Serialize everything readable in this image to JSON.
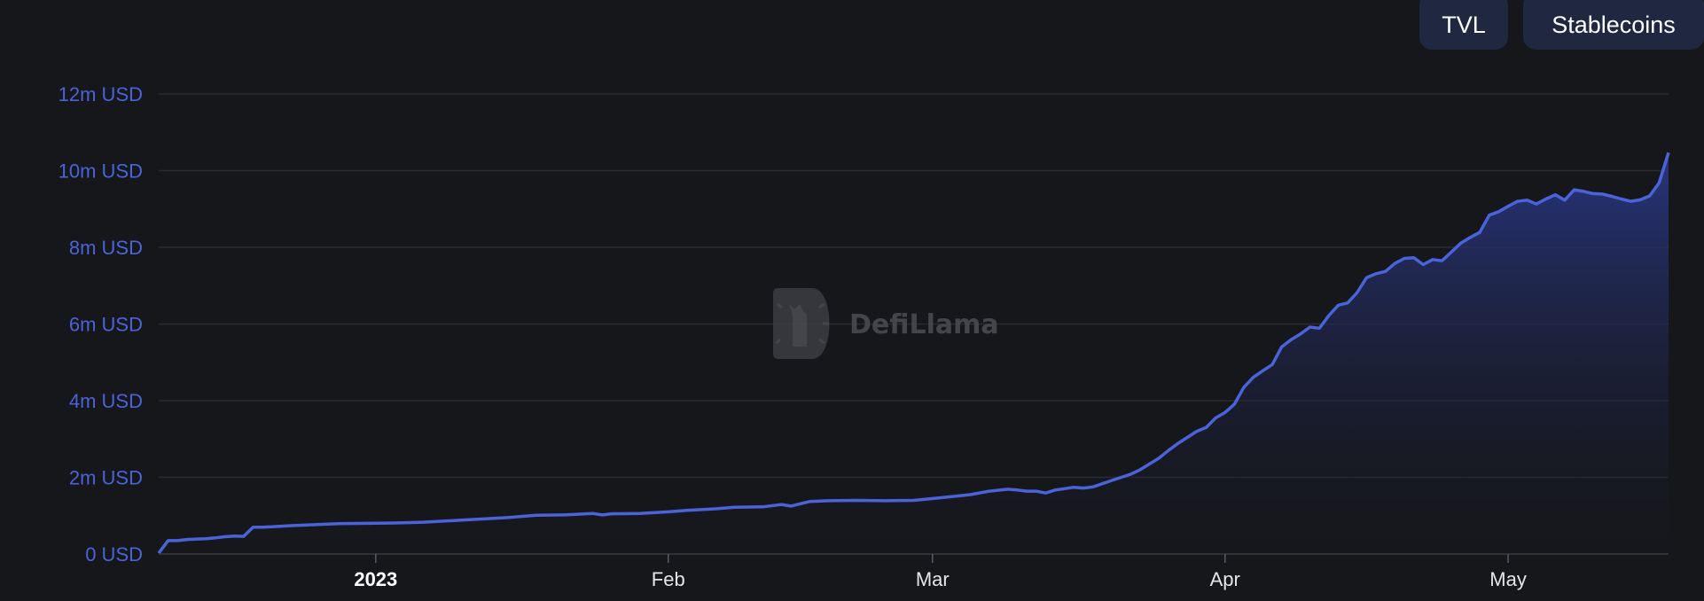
{
  "toggles": [
    {
      "label": "TVL"
    },
    {
      "label": "Stablecoins"
    }
  ],
  "watermark": "DefiLlama",
  "colors": {
    "background": "#16171b",
    "line": "#4b63d9",
    "area_top": "#2b3a8e",
    "grid": "#2a2b31",
    "y_tick_text": "#4b63d9",
    "button_bg": "#1f2840"
  },
  "chart_data": {
    "type": "area",
    "title": "",
    "xlabel": "",
    "ylabel": "",
    "ylim": [
      0,
      12
    ],
    "y_unit": "m USD",
    "y_ticks": [
      {
        "value": 0,
        "label": "0 USD"
      },
      {
        "value": 2,
        "label": "2m USD"
      },
      {
        "value": 4,
        "label": "4m USD"
      },
      {
        "value": 6,
        "label": "6m USD"
      },
      {
        "value": 8,
        "label": "8m USD"
      },
      {
        "value": 10,
        "label": "10m USD"
      },
      {
        "value": 12,
        "label": "12m USD"
      }
    ],
    "x_range": [
      "2022-12-09",
      "2023-05-18"
    ],
    "x_ticks": [
      {
        "date": "2023-01-01",
        "label": "2023",
        "bold": true
      },
      {
        "date": "2023-02-01",
        "label": "Feb",
        "bold": false
      },
      {
        "date": "2023-03-01",
        "label": "Mar",
        "bold": false
      },
      {
        "date": "2023-04-01",
        "label": "Apr",
        "bold": false
      },
      {
        "date": "2023-05-01",
        "label": "May",
        "bold": false
      }
    ],
    "grid": true,
    "legend": "none",
    "series": [
      {
        "x": [
          "2022-12-09",
          "2022-12-10",
          "2022-12-11",
          "2022-12-12",
          "2022-12-13",
          "2022-12-14",
          "2022-12-15",
          "2022-12-16",
          "2022-12-17",
          "2022-12-18",
          "2022-12-19",
          "2022-12-20",
          "2022-12-21",
          "2022-12-23",
          "2022-12-25",
          "2022-12-28",
          "2022-12-31",
          "2023-01-03",
          "2023-01-06",
          "2023-01-09",
          "2023-01-12",
          "2023-01-15",
          "2023-01-18",
          "2023-01-21",
          "2023-01-24",
          "2023-01-25",
          "2023-01-26",
          "2023-01-29",
          "2023-02-01",
          "2023-02-03",
          "2023-02-06",
          "2023-02-08",
          "2023-02-11",
          "2023-02-13",
          "2023-02-14",
          "2023-02-16",
          "2023-02-18",
          "2023-02-21",
          "2023-02-24",
          "2023-02-27",
          "2023-03-02",
          "2023-03-05",
          "2023-03-07",
          "2023-03-09",
          "2023-03-10",
          "2023-03-11",
          "2023-03-12",
          "2023-03-13",
          "2023-03-14",
          "2023-03-16",
          "2023-03-17",
          "2023-03-18",
          "2023-03-20",
          "2023-03-22",
          "2023-03-23",
          "2023-03-25",
          "2023-03-26",
          "2023-03-27",
          "2023-03-29",
          "2023-03-30",
          "2023-03-31",
          "2023-04-01",
          "2023-04-02",
          "2023-04-03",
          "2023-04-04",
          "2023-04-05",
          "2023-04-06",
          "2023-04-07",
          "2023-04-08",
          "2023-04-09",
          "2023-04-10",
          "2023-04-11",
          "2023-04-12",
          "2023-04-13",
          "2023-04-14",
          "2023-04-15",
          "2023-04-16",
          "2023-04-17",
          "2023-04-18",
          "2023-04-19",
          "2023-04-20",
          "2023-04-21",
          "2023-04-22",
          "2023-04-23",
          "2023-04-24",
          "2023-04-25",
          "2023-04-26",
          "2023-04-27",
          "2023-04-28",
          "2023-04-29",
          "2023-04-30",
          "2023-05-01",
          "2023-05-02",
          "2023-05-03",
          "2023-05-04",
          "2023-05-05",
          "2023-05-06",
          "2023-05-07",
          "2023-05-08",
          "2023-05-09",
          "2023-05-10",
          "2023-05-11",
          "2023-05-12",
          "2023-05-13",
          "2023-05-14",
          "2023-05-15",
          "2023-05-16",
          "2023-05-17",
          "2023-05-18"
        ],
        "values": [
          0.02,
          0.35,
          0.35,
          0.38,
          0.39,
          0.4,
          0.42,
          0.45,
          0.47,
          0.46,
          0.7,
          0.7,
          0.71,
          0.74,
          0.76,
          0.79,
          0.8,
          0.81,
          0.83,
          0.87,
          0.91,
          0.95,
          1.01,
          1.02,
          1.06,
          1.02,
          1.05,
          1.06,
          1.1,
          1.14,
          1.18,
          1.22,
          1.23,
          1.29,
          1.25,
          1.37,
          1.39,
          1.4,
          1.39,
          1.4,
          1.47,
          1.55,
          1.64,
          1.69,
          1.67,
          1.64,
          1.64,
          1.59,
          1.67,
          1.74,
          1.72,
          1.75,
          1.92,
          2.08,
          2.2,
          2.5,
          2.7,
          2.88,
          3.2,
          3.3,
          3.55,
          3.69,
          3.91,
          4.35,
          4.61,
          4.78,
          4.94,
          5.4,
          5.59,
          5.74,
          5.92,
          5.89,
          6.22,
          6.49,
          6.55,
          6.82,
          7.21,
          7.31,
          7.37,
          7.58,
          7.71,
          7.73,
          7.55,
          7.68,
          7.65,
          7.88,
          8.11,
          8.26,
          8.39,
          8.84,
          8.93,
          9.07,
          9.2,
          9.23,
          9.13,
          9.26,
          9.37,
          9.23,
          9.5,
          9.46,
          9.4,
          9.39,
          9.33,
          9.26,
          9.2,
          9.24,
          9.34,
          9.68,
          10.47
        ]
      }
    ]
  }
}
